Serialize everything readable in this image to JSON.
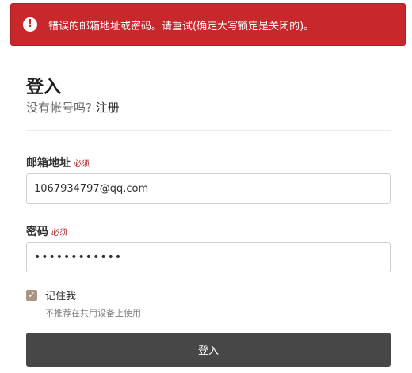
{
  "alert": {
    "icon": "exclamation-circle-icon",
    "icon_glyph": "!",
    "message": "错误的邮箱地址或密码。请重试(确定大写锁定是关闭的)。",
    "background": "#c8272c"
  },
  "form": {
    "title": "登入",
    "signup_prompt": "没有帐号吗?",
    "signup_link": "注册",
    "email": {
      "label": "邮箱地址",
      "required": "必须",
      "value": "1067934797@qq.com"
    },
    "password": {
      "label": "密码",
      "required": "必须",
      "value": "••••••••••••"
    },
    "remember": {
      "label": "记住我",
      "hint": "不推荐在共用设备上使用",
      "checked": true,
      "check_glyph": "✓"
    },
    "submit_label": "登入"
  },
  "colors": {
    "alert": "#c8272c",
    "button": "#474747",
    "checkbox": "#a99682",
    "required": "#b0242b"
  }
}
